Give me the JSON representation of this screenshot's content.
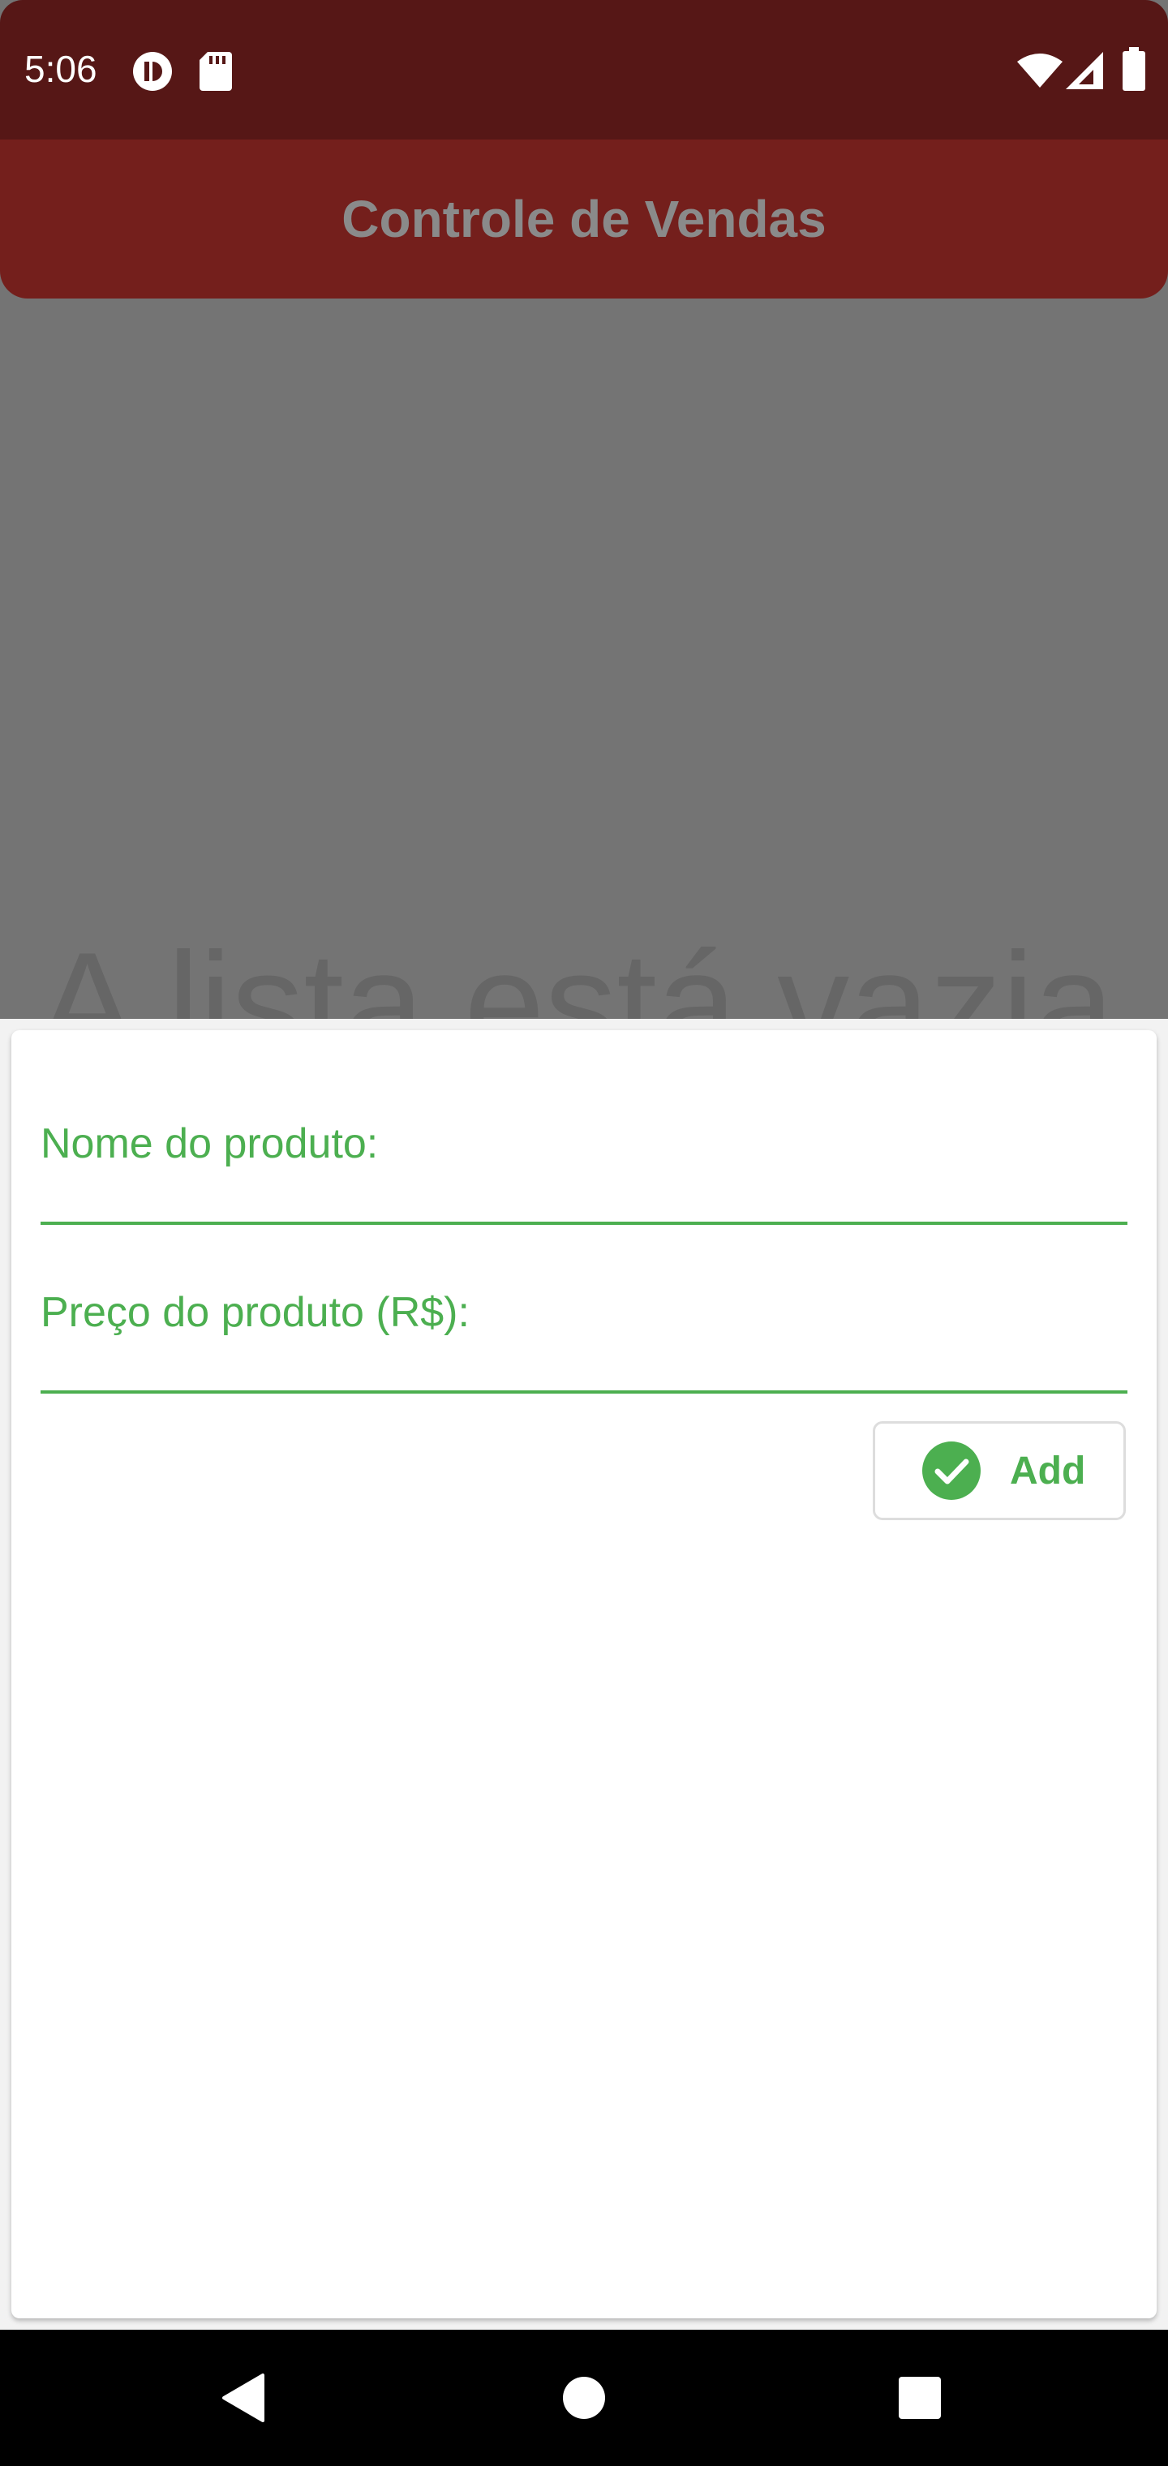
{
  "status_bar": {
    "time": "5:06",
    "icons": [
      "media-icon",
      "sd-card-icon",
      "wifi-icon",
      "signal-icon",
      "battery-icon"
    ]
  },
  "app_bar": {
    "title": "Controle de Vendas"
  },
  "main": {
    "empty_message": "A lista está vazia"
  },
  "form": {
    "product_name_label": "Nome do produto:",
    "product_price_label": "Preço do produto (R$):",
    "add_button_label": "Add"
  },
  "colors": {
    "status_bar": "#561716",
    "app_bar": "#741f1c",
    "accent_green": "#4caf50"
  },
  "nav_bar": {
    "icons": [
      "back-icon",
      "home-icon",
      "recents-icon"
    ]
  }
}
